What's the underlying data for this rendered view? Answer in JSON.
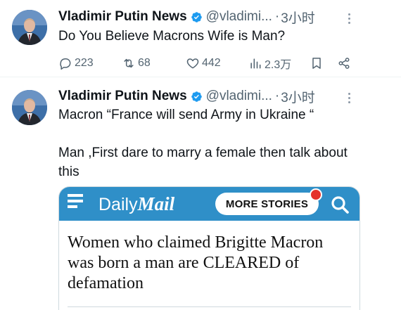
{
  "tweets": [
    {
      "author": "Vladimir Putin News",
      "handle": "@vladimi...",
      "time": "3小时",
      "text": "Do You Believe Macrons Wife is Man?",
      "replies": "223",
      "retweets": "68",
      "likes": "442",
      "views": "2.3万"
    },
    {
      "author": "Vladimir Putin News",
      "handle": "@vladimi...",
      "time": "3小时",
      "text": "Macron “France will send Army in Ukraine “\n\nMan ,First dare to marry a female then talk about this",
      "card": {
        "brand_part1": "Daily",
        "brand_part2": "Mail",
        "more_stories": "MORE STORIES",
        "headline": "Women who claimed Brigitte Macron was born a man are CLEARED of defamation",
        "banner_color": "#2f8fc8"
      }
    }
  ],
  "colors": {
    "verified": "#1d9bf0",
    "secondary_text": "#536471"
  }
}
